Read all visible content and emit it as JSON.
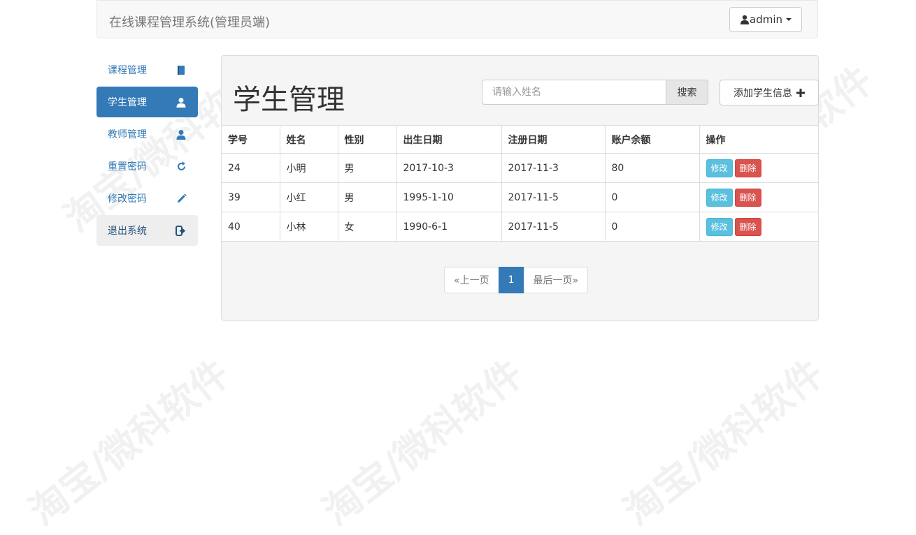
{
  "navbar": {
    "brand": "在线课程管理系统(管理员端)",
    "user_label": "admin"
  },
  "sidebar": {
    "items": [
      {
        "label": "课程管理",
        "icon": "book-icon",
        "active": false
      },
      {
        "label": "学生管理",
        "icon": "user-icon",
        "active": true
      },
      {
        "label": "教师管理",
        "icon": "user-icon",
        "active": false
      },
      {
        "label": "重置密码",
        "icon": "refresh-icon",
        "active": false
      },
      {
        "label": "修改密码",
        "icon": "pencil-icon",
        "active": false
      },
      {
        "label": "退出系统",
        "icon": "logout-icon",
        "active": false
      }
    ]
  },
  "main": {
    "title": "学生管理",
    "search": {
      "placeholder": "请输入姓名",
      "button_label": "搜索"
    },
    "add_button_label": "添加学生信息",
    "table": {
      "columns": [
        "学号",
        "姓名",
        "性别",
        "出生日期",
        "注册日期",
        "账户余额",
        "操作"
      ],
      "rows": [
        [
          "24",
          "小明",
          "男",
          "2017-10-3",
          "2017-11-3",
          "80"
        ],
        [
          "39",
          "小红",
          "男",
          "1995-1-10",
          "2017-11-5",
          "0"
        ],
        [
          "40",
          "小林",
          "女",
          "1990-6-1",
          "2017-11-5",
          "0"
        ]
      ],
      "edit_label": "修改",
      "delete_label": "删除"
    },
    "pagination": {
      "prev": "«上一页",
      "current": "1",
      "last": "最后一页»"
    }
  },
  "watermark": "淘宝/微科软件",
  "colors": {
    "primary": "#337ab7",
    "info": "#5bc0de",
    "danger": "#d9534f"
  }
}
